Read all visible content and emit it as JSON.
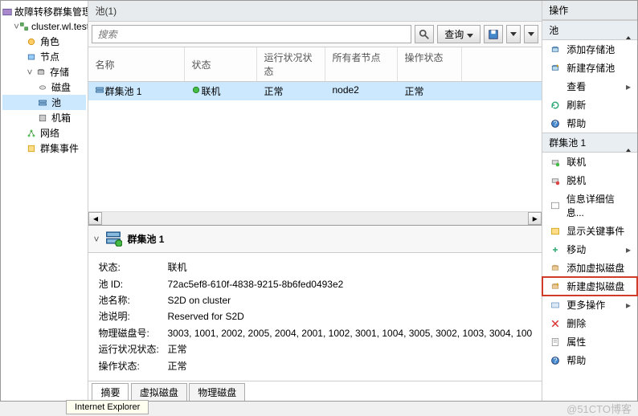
{
  "tree": {
    "root": "故障转移群集管理器",
    "cluster": "cluster.wl.test",
    "roles": "角色",
    "nodes": "节点",
    "storage": "存储",
    "disks": "磁盘",
    "pools": "池",
    "enclosures": "机箱",
    "networks": "网络",
    "events": "群集事件"
  },
  "center": {
    "title": "池(1)",
    "search_placeholder": "搜索",
    "query_btn": "查询",
    "columns": {
      "name": "名称",
      "status": "状态",
      "health": "运行状况状态",
      "owner": "所有者节点",
      "op": "操作状态"
    },
    "row": {
      "name": "群集池 1",
      "status": "联机",
      "health": "正常",
      "owner": "node2",
      "op": "正常"
    }
  },
  "detail": {
    "title": "群集池 1",
    "labels": {
      "status": "状态:",
      "id": "池 ID:",
      "name": "池名称:",
      "desc": "池说明:",
      "disk": "物理磁盘号:",
      "health": "运行状况状态:",
      "op": "操作状态:"
    },
    "values": {
      "status": "联机",
      "id": "72ac5ef8-610f-4838-9215-8b6fed0493e2",
      "name": "S2D on cluster",
      "desc": "Reserved for S2D",
      "disk": "3003, 1001, 2002, 2005, 2004, 2001, 1002, 3001, 1004, 3005, 3002, 1003, 3004, 100",
      "health": "正常",
      "op": "正常"
    },
    "tabs": {
      "summary": "摘要",
      "vdisk": "虚拟磁盘",
      "pdisk": "物理磁盘"
    }
  },
  "actions": {
    "header": "操作",
    "group1": "池",
    "add_pool": "添加存储池",
    "new_pool": "新建存储池",
    "view": "查看",
    "refresh": "刷新",
    "help1": "帮助",
    "group2": "群集池 1",
    "online": "联机",
    "offline": "脱机",
    "info": "信息详细信息...",
    "critical": "显示关键事件",
    "move": "移动",
    "add_vdisk": "添加虚拟磁盘",
    "new_vdisk": "新建虚拟磁盘",
    "more": "更多操作",
    "delete": "删除",
    "props": "属性",
    "help2": "帮助"
  },
  "footer": {
    "ie": "Internet Explorer",
    "watermark": "@51CTO博客"
  }
}
